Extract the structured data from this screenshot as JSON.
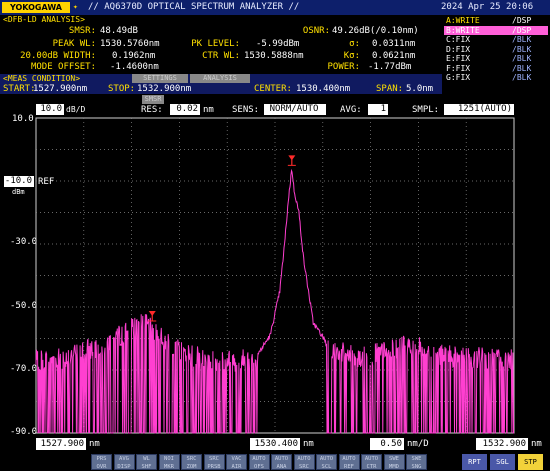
{
  "header": {
    "brand": "YOKOGAWA",
    "model": "// AQ6370D OPTICAL SPECTRUM ANALYZER //",
    "datetime": "2024 Apr 25 20:06"
  },
  "analysis": {
    "title": "<DFB-LD ANALYSIS>",
    "smsr_label": "SMSR:",
    "smsr_value": "48.49dB",
    "osnr_label": "OSNR:",
    "osnr_value": "49.26dB(/0.10nm)",
    "peak_wl_label": "PEAK WL:",
    "peak_wl_value": "1530.5760nm",
    "pk_level_label": "PK LEVEL:",
    "pk_level_value": "-5.99dBm",
    "sigma_label": "σ:",
    "sigma_value": "0.0311nm",
    "width_label": "20.00dB WIDTH:",
    "width_value": "0.1962nm",
    "ctr_wl_label": "CTR WL:",
    "ctr_wl_value": "1530.5888nm",
    "ksigma_label": "Kσ:",
    "ksigma_value": "0.0621nm",
    "mode_offset_label": "MODE OFFSET:",
    "mode_offset_value": "-1.4600nm",
    "power_label": "POWER:",
    "power_value": "-1.77dBm"
  },
  "traces": [
    {
      "name": "A:WRITE",
      "mode": "/DSP",
      "selected": false
    },
    {
      "name": "B:WRITE",
      "mode": "/DSP",
      "selected": true
    },
    {
      "name": "C:FIX",
      "mode": "/BLK",
      "selected": false
    },
    {
      "name": "D:FIX",
      "mode": "/BLK",
      "selected": false
    },
    {
      "name": "E:FIX",
      "mode": "/BLK",
      "selected": false
    },
    {
      "name": "F:FIX",
      "mode": "/BLK",
      "selected": false
    },
    {
      "name": "G:FIX",
      "mode": "/BLK",
      "selected": false
    }
  ],
  "meas": {
    "title": "<MEAS CONDITION>",
    "tab1": "SETTINGS",
    "tab2": "ANALYSIS",
    "start_label": "START:",
    "start_value": "1527.900nm",
    "stop_label": "STOP:",
    "stop_value": "1532.900nm",
    "center_label": "CENTER:",
    "center_value": "1530.400nm",
    "span_label": "SPAN:",
    "span_value": "5.0nm"
  },
  "settings": {
    "ref_scale": "10.0",
    "ref_scale_unit": "dB/D",
    "res_label": "RES:",
    "res_value": "0.02",
    "res_unit": "nm",
    "sens_label": "SENS:",
    "sens_value": "NORM/AUTO",
    "avg_label": "AVG:",
    "avg_value": "1",
    "smpl_label": "SMPL:",
    "smpl_value": "1251(AUTO)",
    "mode_chip": "SMSR"
  },
  "axes": {
    "ref_level": "-10.0",
    "ref_label": "REF",
    "ref_unit": "dBm",
    "y_ticks": [
      "10.0",
      "-30.0",
      "-50.0",
      "-70.0",
      "-90.0"
    ]
  },
  "footer": {
    "start": "1527.900",
    "start_unit": "nm",
    "center": "1530.400",
    "center_unit": "nm",
    "div": "0.50",
    "div_unit": "nm/D",
    "stop": "1532.900",
    "stop_unit": "nm"
  },
  "softkeys": [
    "PRS OVR",
    "AVG DISP",
    "WL SHF",
    "NOI MKR",
    "SRC ZOM",
    "SRC PRSB",
    "VAC AIR",
    "AUTO OFS",
    "AUTO ANA",
    "AUTO SRC",
    "AUTO SCL",
    "AUTO REF",
    "AUTO CTR",
    "SWE MMD",
    "SWE SNG"
  ],
  "mode_keys": [
    "RPT",
    "SGL",
    "STP"
  ],
  "colors": {
    "trace": "#ff3fd0",
    "marker": "#ff2a2a",
    "header_bg": "#0d1f6b",
    "logo": "#ffd200",
    "label_yellow": "#ffe000"
  },
  "chart_data": {
    "type": "line",
    "xlabel": "",
    "ylabel": "",
    "x_range_nm": [
      1527.9,
      1532.9
    ],
    "y_range_dbm": [
      -90,
      10
    ],
    "y_scale_db_per_div": 10,
    "grid": true,
    "series": [
      {
        "x": [
          1527.9,
          1528.2,
          1528.6,
          1528.9,
          1529.0,
          1529.1,
          1529.2,
          1529.4,
          1529.7,
          1530.0,
          1530.2,
          1530.35,
          1530.45,
          1530.5,
          1530.54,
          1530.576,
          1530.6,
          1530.65,
          1530.7,
          1530.8,
          1531.0,
          1531.3,
          1531.6,
          1531.8,
          1532.0,
          1532.3,
          1532.6,
          1532.9
        ],
        "y": [
          -67,
          -66,
          -62,
          -57,
          -55.4,
          -56,
          -59,
          -64,
          -67,
          -67,
          -66,
          -59,
          -45,
          -30,
          -16,
          -6.0,
          -13,
          -20,
          -35,
          -55,
          -64,
          -66,
          -64,
          -62,
          -64,
          -66,
          -66,
          -67
        ]
      }
    ],
    "markers": [
      {
        "x": 1530.576,
        "y": -5.99,
        "label": "peak"
      },
      {
        "x": 1529.116,
        "y": -55.4,
        "label": "side mode"
      }
    ]
  }
}
